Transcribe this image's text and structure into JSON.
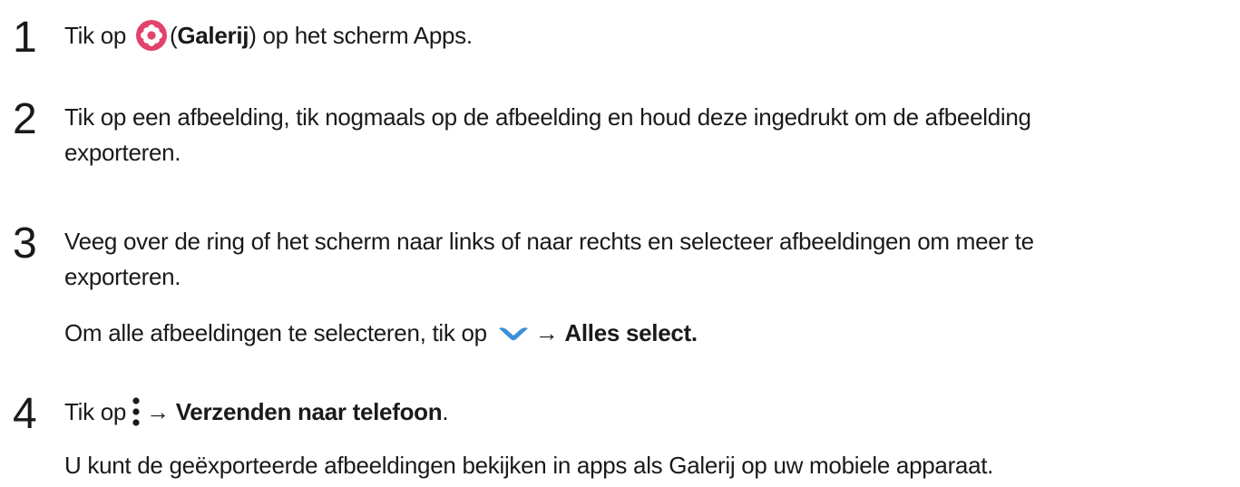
{
  "steps": [
    {
      "number": "1",
      "prefix": "Tik op",
      "icon": "galerij-app-icon",
      "paren_open": "(",
      "bold": "Galerij",
      "suffix": ") op het scherm Apps."
    },
    {
      "number": "2",
      "line1": "Tik op een afbeelding, tik nogmaals op de afbeelding en houd deze ingedrukt om de afbeelding",
      "line2": "exporteren."
    },
    {
      "number": "3",
      "line1": "Veeg over de ring of het scherm naar links of naar rechts en selecteer afbeeldingen om meer te",
      "line2": "exporteren.",
      "note_prefix": "Om alle afbeeldingen te selecteren, tik op",
      "note_icon": "chevron-down-icon",
      "note_arrow": "→",
      "note_bold": "Alles select."
    },
    {
      "number": "4",
      "prefix": "Tik op",
      "icon": "more-options-icon",
      "arrow": "→",
      "bold": "Verzenden naar telefoon",
      "suffix": ".",
      "note": "U kunt de geëxporteerde afbeeldingen bekijken in apps als Galerij op uw mobiele apparaat."
    }
  ],
  "colors": {
    "text": "#1a1a1a",
    "galerij_icon": "#e2436b",
    "chevron_icon": "#3b8fd9"
  }
}
